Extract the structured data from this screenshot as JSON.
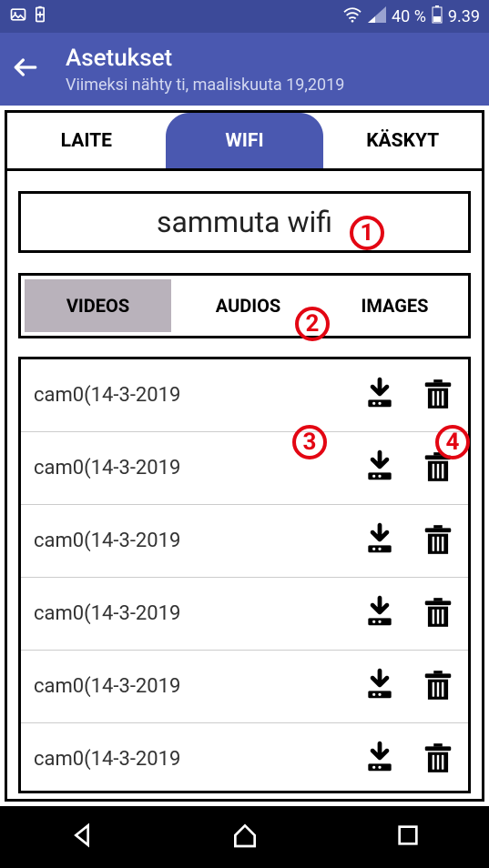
{
  "status": {
    "battery_pct": "40 %",
    "time": "9.39"
  },
  "header": {
    "title": "Asetukset",
    "subtitle": "Viimeksi nähty ti, maaliskuuta 19,2019"
  },
  "tabs": {
    "device": "LAITE",
    "wifi": "WIFI",
    "commands": "KÄSKYT"
  },
  "wifi_toggle_label": "sammuta wifi",
  "media_tabs": {
    "videos": "VIDEOS",
    "audios": "AUDIOS",
    "images": "IMAGES"
  },
  "files": [
    {
      "name": "cam0(14-3-2019"
    },
    {
      "name": "cam0(14-3-2019"
    },
    {
      "name": "cam0(14-3-2019"
    },
    {
      "name": "cam0(14-3-2019"
    },
    {
      "name": "cam0(14-3-2019"
    },
    {
      "name": "cam0(14-3-2019"
    }
  ],
  "annotations": {
    "a1": "1",
    "a2": "2",
    "a3": "3",
    "a4": "4"
  }
}
